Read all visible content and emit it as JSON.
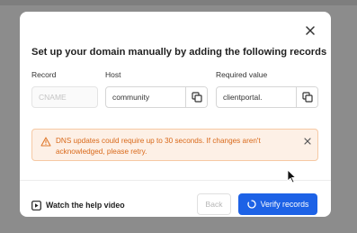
{
  "dialog": {
    "title": "Set up your domain manually by adding the following records",
    "close_icon": "close-icon"
  },
  "records": {
    "record_label": "Record",
    "host_label": "Host",
    "value_label": "Required value",
    "record_value": "CNAME",
    "host_value": "community",
    "required_value": "clientportal.",
    "copy_icon": "copy-icon"
  },
  "alert": {
    "text": "DNS updates could require up to 30 seconds. If changes aren't acknowledged, please retry.",
    "icon": "warning-icon",
    "color": "#d9691a",
    "background": "#fdf0e6"
  },
  "footer": {
    "help_label": "Watch the help video",
    "help_icon": "play-icon",
    "back_label": "Back",
    "verify_label": "Verify records",
    "verify_color": "#1d62e6",
    "loading_icon": "spinner-icon"
  }
}
